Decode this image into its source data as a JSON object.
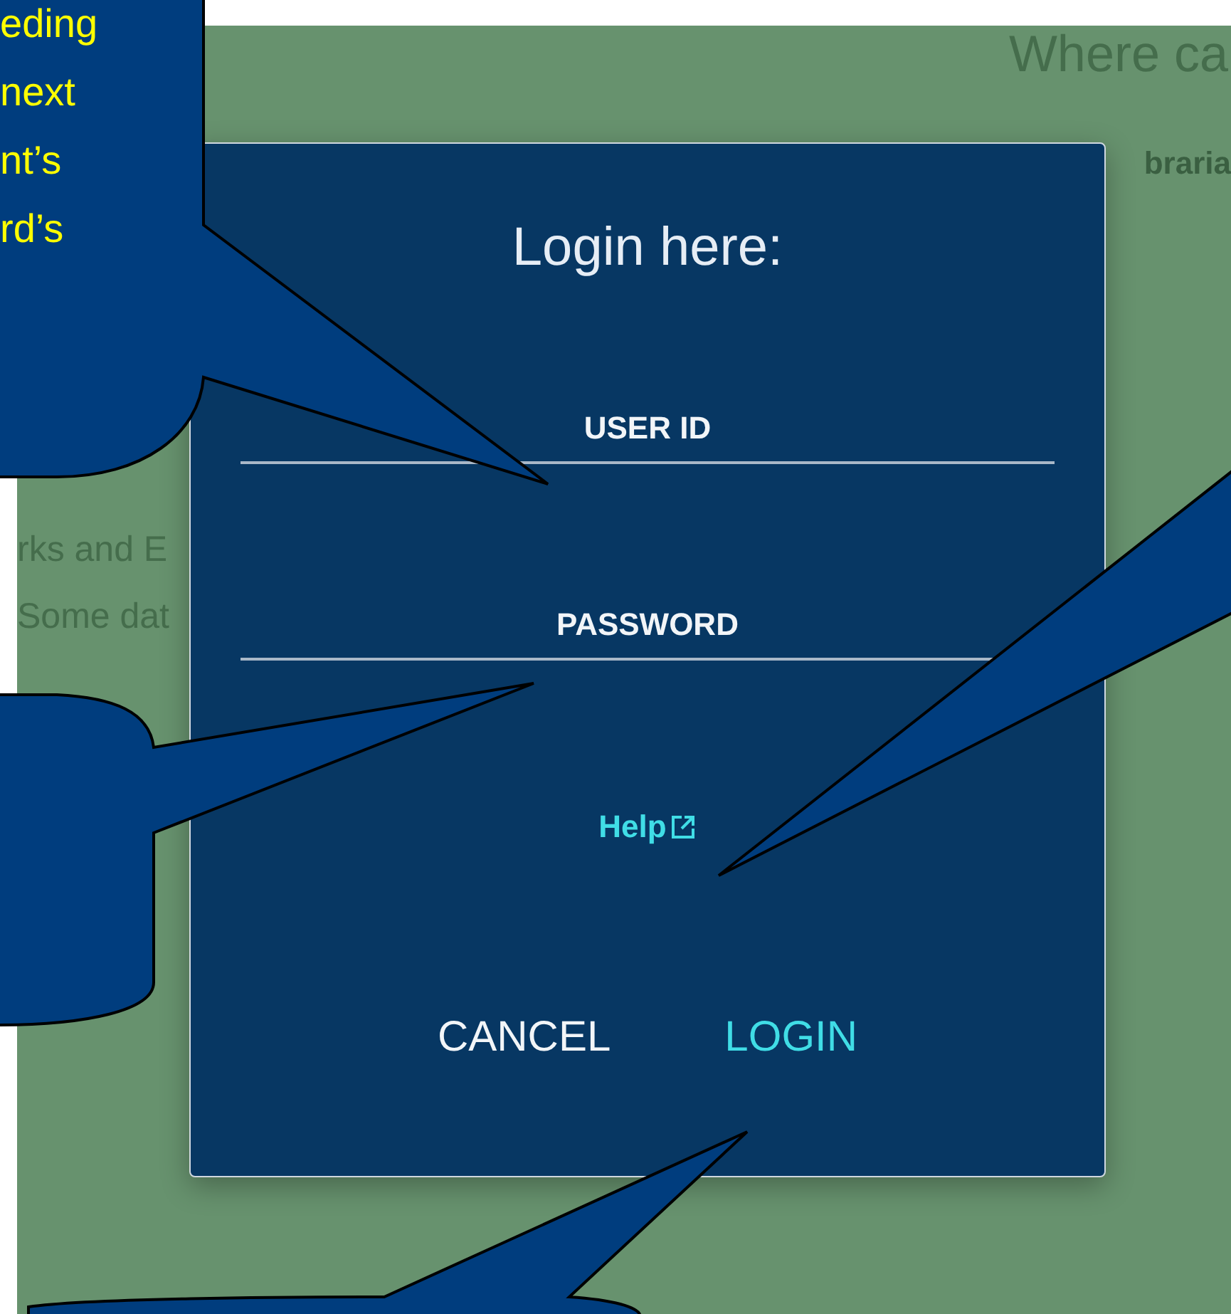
{
  "page": {
    "heading": "Where ca",
    "tab_fragment": "braria",
    "lines": [
      "rks and E",
      "Some dat"
    ]
  },
  "dialog": {
    "title": "Login here:",
    "fields": [
      {
        "label": "USER ID"
      },
      {
        "label": "PASSWORD"
      }
    ],
    "help_link": "Help",
    "buttons": [
      {
        "label": "CANCEL",
        "kind": "secondary"
      },
      {
        "label": "LOGIN",
        "kind": "primary"
      }
    ]
  },
  "callout": {
    "lines": [
      "eding",
      "next",
      "nt’s",
      "rd’s"
    ]
  }
}
